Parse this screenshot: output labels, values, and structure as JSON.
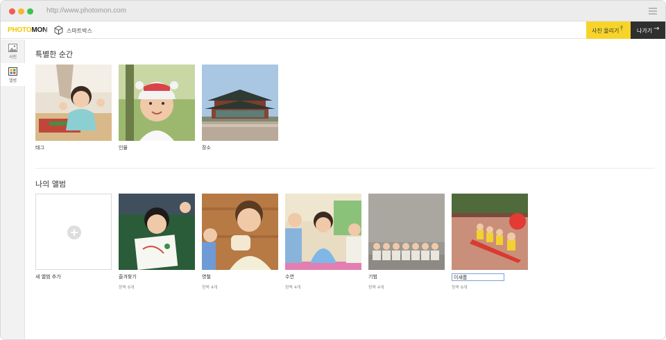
{
  "browser": {
    "url": "http://www.photomon.com"
  },
  "header": {
    "logo_photo": "PHOTO",
    "logo_mon": "MON",
    "smartbox_label": "스마트박스",
    "upload_label": "사진 올리기",
    "back_label": "나가기"
  },
  "sidebar": {
    "items": [
      {
        "label": "사진",
        "icon": "photo-icon"
      },
      {
        "label": "앨범",
        "icon": "album-icon"
      }
    ]
  },
  "special_moments": {
    "title": "특별한 순간",
    "items": [
      {
        "label": "태그"
      },
      {
        "label": "인물"
      },
      {
        "label": "장소"
      }
    ]
  },
  "my_albums": {
    "title": "나의 앨범",
    "add_label": "새 앨범 추가",
    "albums": [
      {
        "label": "즐겨찾기",
        "count": "항목 6개"
      },
      {
        "label": "영철",
        "count": "항목 4개"
      },
      {
        "label": "수연",
        "count": "항목 4개"
      },
      {
        "label": "기범",
        "count": "항목 4개"
      },
      {
        "label": "이새롬",
        "count": "항목 6개"
      }
    ]
  },
  "colors": {
    "accent_yellow": "#f7d42a",
    "dark_button": "#2f2f2f"
  }
}
